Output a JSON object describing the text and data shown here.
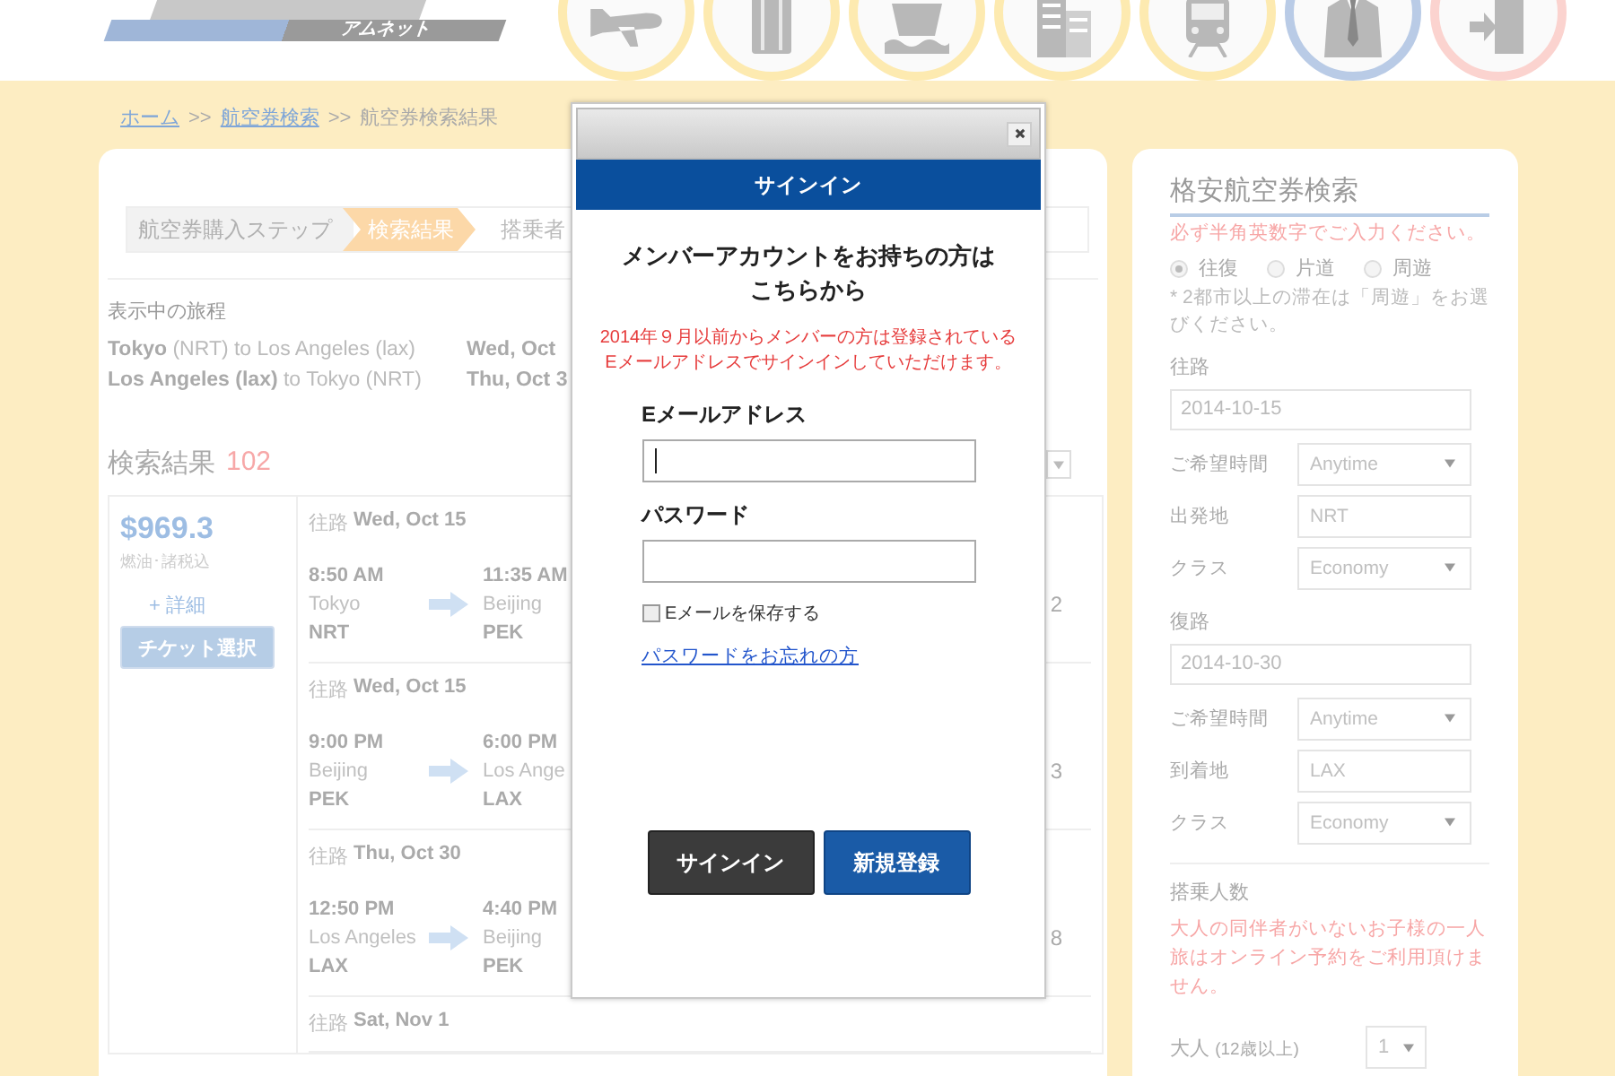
{
  "header": {
    "logo_caption": "アムネット",
    "nav_icons": [
      {
        "kind": "plane",
        "color": "#fdeab0"
      },
      {
        "kind": "suitcase",
        "color": "#fdeab0"
      },
      {
        "kind": "ship",
        "color": "#fdeab0"
      },
      {
        "kind": "building",
        "color": "#fdeab0"
      },
      {
        "kind": "train",
        "color": "#fdeab0"
      },
      {
        "kind": "suit",
        "color": "#b9cbe6"
      },
      {
        "kind": "exit",
        "color": "#fbd3cf"
      }
    ]
  },
  "breadcrumb": [
    {
      "label": "ホーム",
      "kind": "link"
    },
    {
      "label": ">>",
      "kind": "separator"
    },
    {
      "label": "航空券検索",
      "kind": "link"
    },
    {
      "label": ">>",
      "kind": "separator"
    },
    {
      "label": "航空券検索結果",
      "kind": "current"
    }
  ],
  "steps": {
    "title": "航空券購入ステップ",
    "items": [
      {
        "label": "検索結果",
        "selected": true
      },
      {
        "label": "搭乗者",
        "selected": false
      }
    ]
  },
  "itinerary": {
    "title": "表示中の旅程",
    "rows": [
      {
        "route": "**Tokyo** (NRT) to Los Angeles (lax)",
        "date": "Wed, Oct"
      },
      {
        "route": "**Los Angeles (lax)** to Tokyo (NRT)",
        "date": "Thu, Oct 3"
      }
    ]
  },
  "results": {
    "title": "検索結果",
    "count": "102",
    "offer": {
      "price": "$969.3",
      "price_note": "燃油･諸税込",
      "details_link": "+ 詳細",
      "select_button": "チケット選択"
    },
    "segments": [
      {
        "direction": "往路",
        "date": "Wed, Oct 15",
        "depart": {
          "time": "8:50 AM",
          "city": "Tokyo",
          "code": "NRT"
        },
        "arrive": {
          "time": "11:35 AM",
          "city": "Beijing",
          "code": "PEK"
        },
        "column_3": "2"
      },
      {
        "direction": "往路",
        "date": "Wed, Oct 15",
        "depart": {
          "time": "9:00 PM",
          "city": "Beijing",
          "code": "PEK"
        },
        "arrive": {
          "time": "6:00 PM",
          "city": "Los Ange",
          "code": "LAX"
        },
        "column_3": "3"
      },
      {
        "direction": "往路",
        "date": "Thu, Oct 30",
        "depart": {
          "time": "12:50 PM",
          "city": "Los Angeles",
          "code": "LAX"
        },
        "arrive": {
          "time": "4:40 PM",
          "city": "Beijing",
          "code": "PEK"
        },
        "column_3": "8"
      },
      {
        "direction": "往路",
        "date": "Sat, Nov 1"
      }
    ]
  },
  "signin_dialog": {
    "header": "サインイン",
    "heading_lines": [
      "メンバーアカウントをお持ちの方は",
      "こちらから"
    ],
    "notice_lines": [
      "2014年９月以前からメンバーの方は登録されている",
      "Eメールアドレスでサインインしていただけます。"
    ],
    "email_label": "Eメールアドレス",
    "email_focused": true,
    "password_label": "パスワード",
    "remember": {
      "label": "Eメールを保存する",
      "checked": false
    },
    "forgot_link": "パスワードをお忘れの方",
    "buttons": [
      {
        "label": "サインイン",
        "kind": "secondary"
      },
      {
        "label": "新規登録",
        "kind": "primary"
      }
    ]
  },
  "search_panel": {
    "title": "格安航空券検索",
    "notice": "必ず半角英数字でご入力ください。",
    "trip_types": [
      {
        "label": "往復",
        "selected": true
      },
      {
        "label": "片道",
        "selected": false
      },
      {
        "label": "周遊",
        "selected": false
      }
    ],
    "trip_note": "* 2都市以上の滞在は「周遊」をお選びください。",
    "legs": [
      {
        "title": "往路",
        "date": "2014-10-15",
        "fields": [
          {
            "label": "ご希望時間",
            "value": "Anytime",
            "kind": "select"
          },
          {
            "label": "出発地",
            "value": "NRT",
            "kind": "text"
          },
          {
            "label": "クラス",
            "value": "Economy",
            "kind": "select"
          }
        ]
      },
      {
        "title": "復路",
        "date": "2014-10-30",
        "fields": [
          {
            "label": "ご希望時間",
            "value": "Anytime",
            "kind": "select"
          },
          {
            "label": "到着地",
            "value": "LAX",
            "kind": "text"
          },
          {
            "label": "クラス",
            "value": "Economy",
            "kind": "select"
          }
        ]
      }
    ],
    "passengers": {
      "title": "搭乗人数",
      "notice": "大人の同伴者がいないお子様の一人旅はオンライン予約をご利用頂けません。",
      "rows": [
        {
          "label": "大人",
          "note": "(12歳以上)",
          "value": "1"
        }
      ]
    }
  }
}
